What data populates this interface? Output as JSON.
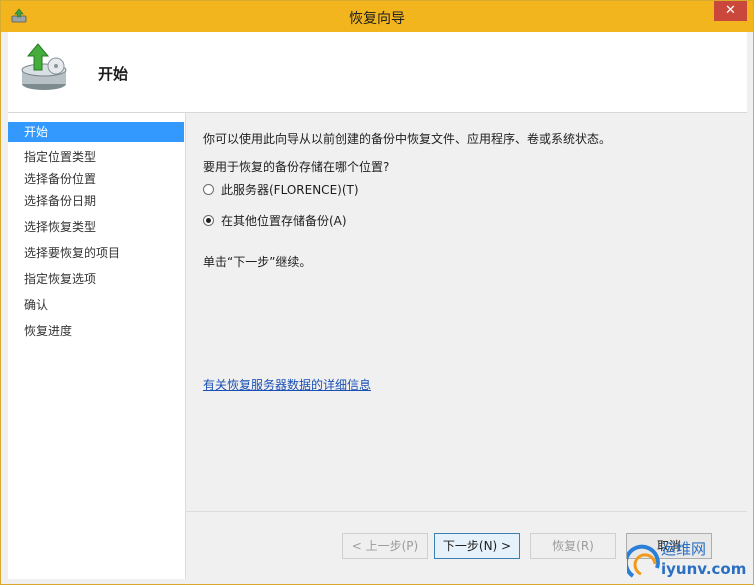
{
  "window": {
    "title": "恢复向导",
    "close_glyph": "✕"
  },
  "header": {
    "title": "开始",
    "icon": "backup-restore-icon"
  },
  "sidebar": {
    "items": [
      {
        "label": "开始",
        "active": true
      },
      {
        "label": "指定位置类型",
        "active": false
      },
      {
        "label": "选择备份位置",
        "active": false
      },
      {
        "label": "选择备份日期",
        "active": false
      },
      {
        "label": "选择恢复类型",
        "active": false
      },
      {
        "label": "选择要恢复的项目",
        "active": false
      },
      {
        "label": "指定恢复选项",
        "active": false
      },
      {
        "label": "确认",
        "active": false
      },
      {
        "label": "恢复进度",
        "active": false
      }
    ]
  },
  "main": {
    "intro": "你可以使用此向导从以前创建的备份中恢复文件、应用程序、卷或系统状态。",
    "question": "要用于恢复的备份存储在哪个位置?",
    "options": [
      {
        "label": "此服务器(FLORENCE)(T)",
        "checked": false
      },
      {
        "label": "在其他位置存储备份(A)",
        "checked": true
      }
    ],
    "instruction": "单击“下一步”继续。",
    "help_link": "有关恢复服务器数据的详细信息"
  },
  "footer": {
    "back": "< 上一步(P)",
    "next": "下一步(N) >",
    "restore": "恢复(R)",
    "cancel": "取消"
  },
  "watermark": {
    "text": "运维网",
    "url": "iyunv.com"
  },
  "colors": {
    "titlebar": "#f2b51e",
    "accent": "#3399ff",
    "link": "#1a4fb3",
    "close": "#c9473b"
  }
}
